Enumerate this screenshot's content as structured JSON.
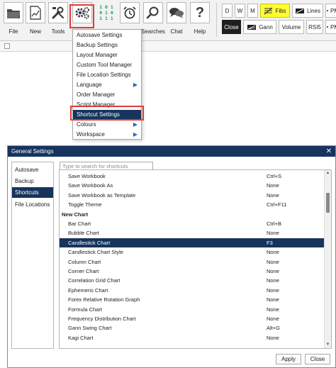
{
  "toolbar": {
    "buttons": [
      {
        "label": "File",
        "icon": "folder-icon"
      },
      {
        "label": "New",
        "icon": "new-chart-icon"
      },
      {
        "label": "Tools",
        "icon": "tools-icon"
      },
      {
        "label": "",
        "icon": "gear-icon"
      },
      {
        "label": "",
        "icon": "binary-icon",
        "bits": [
          "1 0 1",
          "0 1 0",
          "1 1 1"
        ]
      },
      {
        "label": "",
        "icon": "alarm-clock-icon"
      },
      {
        "label": "Searches",
        "icon": "search-icon"
      },
      {
        "label": "Chat",
        "icon": "chat-icon"
      },
      {
        "label": "Help",
        "icon": "help-icon",
        "glyph": "?"
      }
    ],
    "right_row1": [
      {
        "label": "D"
      },
      {
        "label": "W"
      },
      {
        "label": "M"
      },
      {
        "label": "Fibs",
        "icon": "fibs-icon"
      },
      {
        "label": "Lines",
        "icon": "lines-icon"
      },
      {
        "label": "PM",
        "icon": "pm-icon"
      }
    ],
    "right_row2": [
      {
        "label": "Close"
      },
      {
        "label": "Gann",
        "icon": "gann-icon"
      },
      {
        "label": "Volume"
      },
      {
        "label": "RSI5"
      },
      {
        "label": "PM",
        "icon": "pm-icon"
      }
    ]
  },
  "tools_menu": {
    "items": [
      {
        "label": "Autosave Settings",
        "submenu": false
      },
      {
        "label": "Backup Settings",
        "submenu": false
      },
      {
        "label": "Layout Manager",
        "submenu": false
      },
      {
        "label": "Custom Tool Manager",
        "submenu": false
      },
      {
        "label": "File Location Settings",
        "submenu": false
      },
      {
        "label": "Language",
        "submenu": true
      },
      {
        "label": "Order Manager",
        "submenu": false
      },
      {
        "label": "Script Manager",
        "submenu": false
      },
      {
        "label": "Shortcut Settings",
        "submenu": false,
        "selected": true
      },
      {
        "label": "Colours",
        "submenu": true
      },
      {
        "label": "Workspace",
        "submenu": true
      }
    ]
  },
  "dialog": {
    "title": "General Settings",
    "close_glyph": "✕",
    "nav": [
      {
        "label": "Autosave"
      },
      {
        "label": "Backup"
      },
      {
        "label": "Shortcuts",
        "active": true
      },
      {
        "label": "File Locations"
      }
    ],
    "search_placeholder": "Type to search for shortcuts",
    "rows": [
      {
        "name": "Save Workbook",
        "key": "Ctrl+S"
      },
      {
        "name": "Save Workbook As",
        "key": "None"
      },
      {
        "name": "Save Workbook as Template",
        "key": "None"
      },
      {
        "name": "Toggle Theme",
        "key": "Ctrl+F11"
      },
      {
        "name": "New Chart",
        "key": "",
        "group": true
      },
      {
        "name": "Bar Chart",
        "key": "Ctrl+B"
      },
      {
        "name": "Bubble Chart",
        "key": "None"
      },
      {
        "name": "Candlestick Chart",
        "key": "F3",
        "selected": true
      },
      {
        "name": "Candlestick Chart Style",
        "key": "None"
      },
      {
        "name": "Column Chart",
        "key": "None"
      },
      {
        "name": "Corner Chart",
        "key": "None"
      },
      {
        "name": "Correlation Grid Chart",
        "key": "None"
      },
      {
        "name": "Ephemeris Chart",
        "key": "None"
      },
      {
        "name": "Forex Relative Rotation Graph",
        "key": "None"
      },
      {
        "name": "Formula Chart",
        "key": "None"
      },
      {
        "name": "Frequency Distribution Chart",
        "key": "None"
      },
      {
        "name": "Gann Swing Chart",
        "key": "Alt+G"
      },
      {
        "name": "Kagi Chart",
        "key": "None"
      }
    ],
    "apply_label": "Apply",
    "close_label": "Close"
  },
  "colors": {
    "accent": "#16345c",
    "highlight_red": "#e23b3b",
    "fibs_yellow": "#ffff33"
  }
}
